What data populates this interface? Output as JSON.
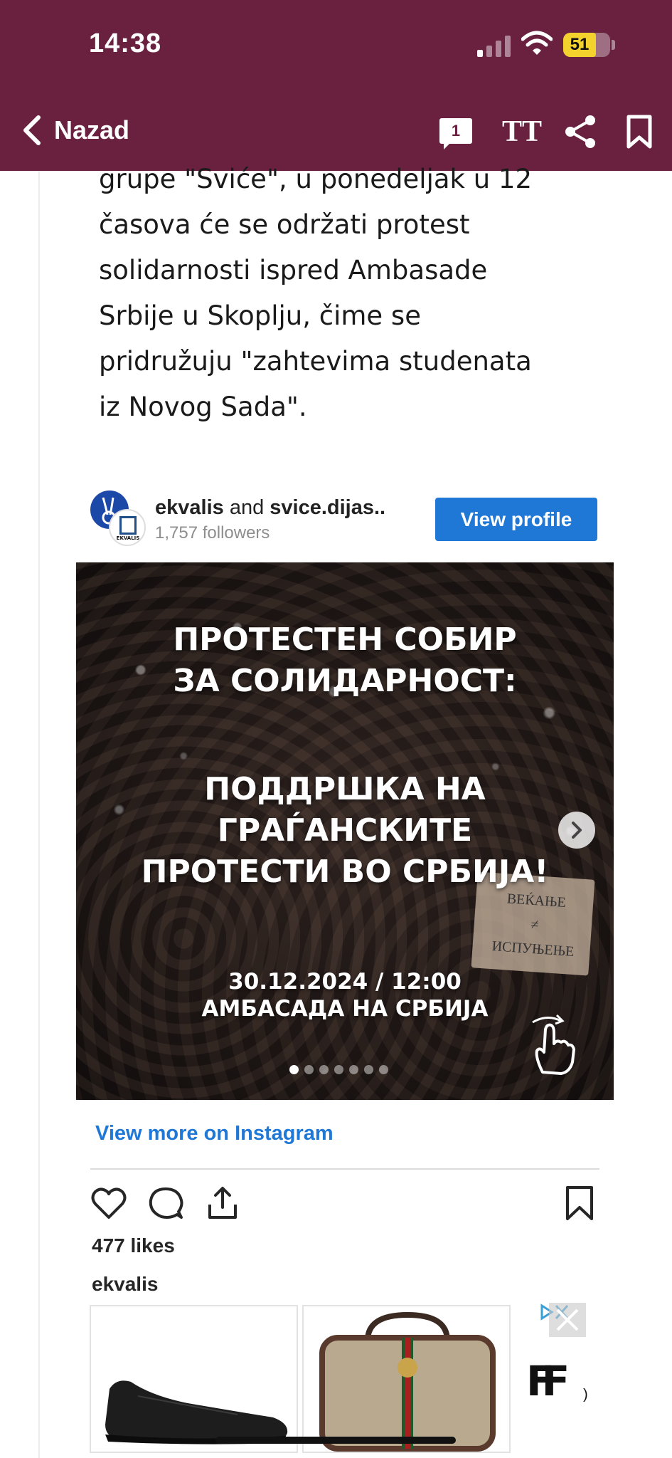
{
  "status_bar": {
    "time": "14:38",
    "battery_level": "51",
    "signal_bars_on": 1,
    "signal_bars_total": 4
  },
  "header": {
    "back_label": "Nazad",
    "comment_count": "1",
    "text_size_label": "TT",
    "background_color": "#6a2140"
  },
  "article": {
    "lines": [
      "grupe \"Sviće\", u ponedeljak u 12",
      "časova će se održati protest",
      "solidarnosti ispred Ambasade",
      "Srbije u Skoplju, čime se",
      "pridružuju \"zahtevima studenata",
      "iz Novog Sada\"."
    ]
  },
  "instagram": {
    "user1": "ekvalis",
    "connector": " and ",
    "user2": "svice.dijas..",
    "followers": "1,757 followers",
    "avatar2_label": "EKVALIS",
    "view_profile": "View profile",
    "photo_headline_1_line1": "ПРОТЕСТЕН СОБИР",
    "photo_headline_1_line2": "ЗА СОЛИДАРНОСТ:",
    "photo_headline_2_line1": "ПОДДРШКА НА",
    "photo_headline_2_line2": "ГРАЃАНСКИТЕ",
    "photo_headline_2_line3": "ПРОТЕСТИ ВО СРБИЈА!",
    "photo_date_line": "30.12.2024 / 12:00",
    "photo_place_line": "АМБАСАДА НА СРБИЈА",
    "sign_line1": "ВЕЌАЊЕ",
    "sign_line2": "≠",
    "sign_line3": "ИСПУЊЕЊЕ",
    "carousel_total": 7,
    "carousel_active": 0,
    "view_more": "View more on Instagram",
    "likes": "477 likes",
    "caption_user": "ekvalis",
    "accent_color": "#1f77d6"
  },
  "ad": {
    "logo": "FF",
    "fragment": ")"
  }
}
